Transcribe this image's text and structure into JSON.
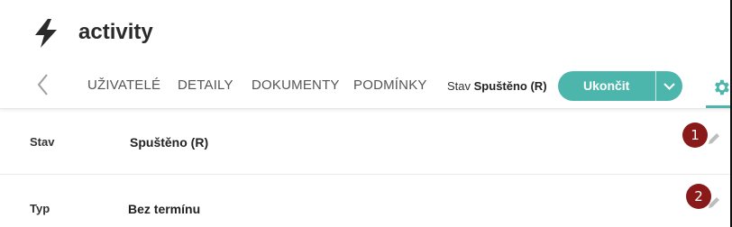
{
  "app": {
    "title": "activity",
    "icon": "lightning-bolt-icon"
  },
  "nav": {
    "back_icon": "chevron-left-icon",
    "tabs": [
      {
        "label": "UŽIVATELÉ"
      },
      {
        "label": "DETAILY"
      },
      {
        "label": "DOKUMENTY"
      },
      {
        "label": "PODMÍNKY"
      }
    ],
    "state_label": "Stav",
    "state_value": "Spuštěno (R)",
    "action_button": {
      "label": "Ukončit",
      "dropdown_icon": "chevron-down-icon"
    },
    "settings_icon": "gear-icon"
  },
  "details": [
    {
      "label": "Stav",
      "value": "Spuštěno (R)",
      "badge": "1",
      "edit_icon": "pencil-icon"
    },
    {
      "label": "Typ",
      "value": "Bez termínu",
      "badge": "2",
      "edit_icon": "pencil-icon"
    }
  ],
  "colors": {
    "accent": "#4db6ac",
    "badge": "#8a1a1a",
    "text": "#212121"
  }
}
